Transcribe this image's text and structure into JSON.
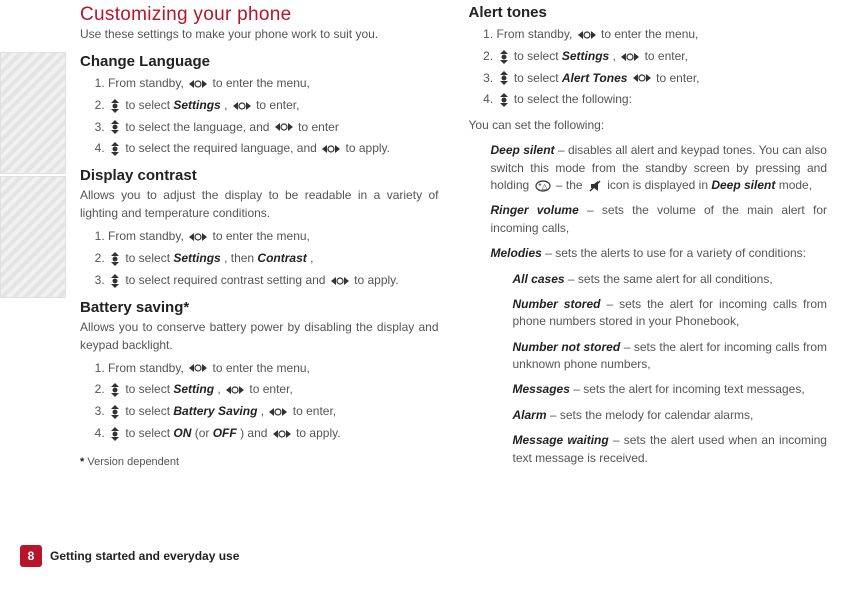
{
  "footer": {
    "pageNumber": "8",
    "text": "Getting started and everyday use"
  },
  "left": {
    "title": "Customizing your phone",
    "intro": "Use these settings to make your phone work to suit you.",
    "changeLang": {
      "heading": "Change Language",
      "s1a": "From standby, ",
      "s1b": " to enter the menu,",
      "s2a": "",
      "s2b": " to select ",
      "s2settings": "Settings",
      "s2c": ", ",
      "s2d": " to enter,",
      "s3a": "",
      "s3b": " to select the language, and ",
      "s3c": " to enter",
      "s4a": "",
      "s4b": " to select the required language, and ",
      "s4c": " to apply."
    },
    "contrast": {
      "heading": "Display contrast",
      "desc": "Allows you to adjust the display to be readable in a variety of lighting and temperature conditions.",
      "s1a": "From standby, ",
      "s1b": " to enter the menu,",
      "s2a": "",
      "s2b": " to select ",
      "s2settings": "Settings",
      "s2c": ", then ",
      "s2contrast": "Contrast",
      "s2d": ",",
      "s3a": "",
      "s3b": " to select required contrast setting and ",
      "s3c": " to apply."
    },
    "battery": {
      "heading": "Battery saving*",
      "desc": "Allows you to conserve battery power by disabling the display and keypad backlight.",
      "s1a": "From standby, ",
      "s1b": " to enter the menu,",
      "s2a": "",
      "s2b": " to select ",
      "s2setting": "Setting",
      "s2c": ", ",
      "s2d": " to enter,",
      "s3a": "",
      "s3b": " to select ",
      "s3bs": "Battery Saving",
      "s3c": ", ",
      "s3d": " to enter,",
      "s4a": "",
      "s4b": " to select ",
      "s4on": "ON",
      "s4mid": " (or ",
      "s4off": "OFF",
      "s4c": ") and ",
      "s4d": " to apply."
    },
    "footnoteStar": "*",
    "footnote": "Version dependent"
  },
  "right": {
    "heading": "Alert tones",
    "s1a": "From standby, ",
    "s1b": " to enter the menu,",
    "s2a": "",
    "s2b": " to select ",
    "s2settings": "Settings",
    "s2c": ", ",
    "s2d": " to enter,",
    "s3a": "",
    "s3b": " to select  ",
    "s3alert": "Alert Tones",
    "s3c": " ",
    "s3d": " to enter,",
    "s4a": "",
    "s4b": " to select the following:",
    "setIntro": "You can set the following:",
    "deepSilent": {
      "label": "Deep silent",
      "t1": " – disables all alert and keypad tones. You can also switch this mode from the standby screen by pressing and holding ",
      "t2": " – the ",
      "t3": " icon is displayed in ",
      "mode": "Deep silent",
      "t4": " mode,"
    },
    "ringer": {
      "label": "Ringer volume",
      "text": " – sets the volume of the main alert for incoming calls,"
    },
    "melodies": {
      "label": "Melodies",
      "text": " – sets the alerts to use for a variety of conditions:"
    },
    "allCases": {
      "label": "All cases",
      "text": " – sets the same alert for all conditions,"
    },
    "numStored": {
      "label": "Number stored",
      "text": " – sets the alert for incoming calls from phone numbers stored in your Phonebook,"
    },
    "numNotStored": {
      "label": "Number not stored",
      "text": " – sets the alert for incoming calls from unknown phone numbers,"
    },
    "messages": {
      "label": "Messages",
      "text": " – sets the alert for incoming text messages,"
    },
    "alarm": {
      "label": "Alarm",
      "text": " – sets the melody for calendar alarms,"
    },
    "msgWait": {
      "label": "Message waiting",
      "text": " – sets the alert used when an incoming text message is received."
    }
  }
}
